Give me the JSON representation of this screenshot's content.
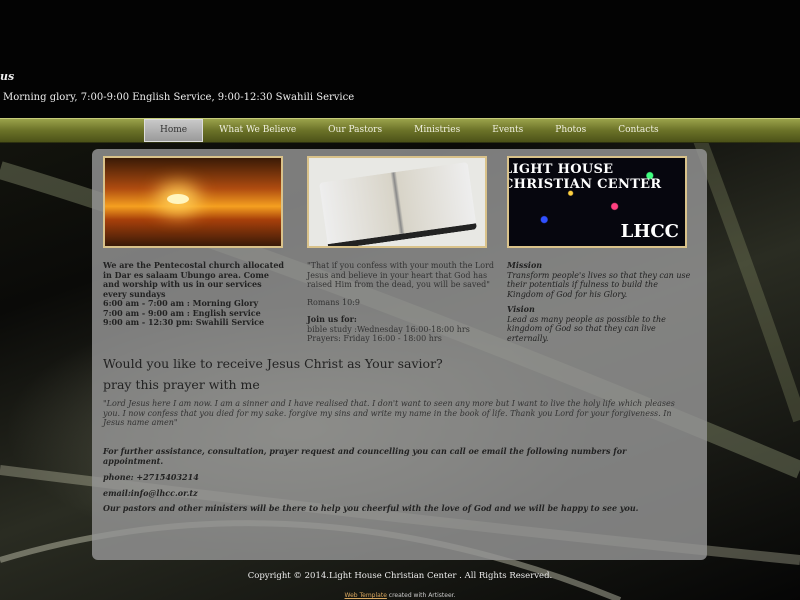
{
  "header": {
    "title": "us",
    "schedule": "Morning glory, 7:00-9:00 English Service, 9:00-12:30 Swahili Service"
  },
  "nav": {
    "items": [
      {
        "label": "Home"
      },
      {
        "label": "What We Believe"
      },
      {
        "label": "Our Pastors"
      },
      {
        "label": "Ministries"
      },
      {
        "label": "Events"
      },
      {
        "label": "Photos"
      },
      {
        "label": "Contacts"
      }
    ],
    "active": "Home"
  },
  "images": {
    "lhcc_text": "LIGHT HOUSE CHRISTIAN CENTER",
    "lhcc_logo": "LHCC"
  },
  "col1": {
    "intro": "We are the Pentecostal church allocated in Dar es salaam Ubungo area.  Come and worship with us in our services every sundays",
    "schedule": [
      "6:00 am - 7:00 am  : Morning Glory",
      "7:00 am - 9:00 am  : English service",
      "9:00 am - 12:30 pm: Swahili Service"
    ]
  },
  "col2": {
    "verse": "\"That if you confess with your mouth the Lord Jesus and believe in your heart that God has raised Him from the dead, you will be saved\"",
    "reference": "Romans 10:9",
    "join_title": "Join us for:",
    "join_items": [
      "bible study :Wednesday 16:00-18:00 hrs",
      "Prayers: Friday 16:00 - 18:00 hrs"
    ]
  },
  "col3": {
    "mission_title": "Mission",
    "mission_text": " Transform people's  lives so that they can use their potentials if fulness to build the Kingdom of God for his Glory.",
    "vision_title": "Vision",
    "vision_text": "Lead as many people as possible to the kingdom of God so that they can live erternally."
  },
  "main": {
    "question": "Would you like to receive Jesus Christ as Your savior?",
    "prayer_intro": "pray this prayer with me",
    "prayer": "\"Lord Jesus here I am now. I am a sinner and I have realised that. I don't want to seen any more but I want to live the holy life which pleases you. I now confess that you died for my sake. forgive my sins and write my name in the book of life. Thank you Lord for your forgiveness. In Jesus name amen\"",
    "assistance": "For further assistance, consultation, prayer request and councelling you can call oe email the following numbers for appointment.",
    "phone": "phone: +2715403214",
    "email": "email:info@lhcc.or.tz",
    "closing": "Our pastors and other ministers will be there to help you cheerful with the love of God and we will be  happy to see you."
  },
  "footer": {
    "copyright": "Copyright © 2014.Light House Christian Center . All Rights Reserved.",
    "template_link": "Web Template",
    "template_suffix": " created with Artisteer."
  }
}
